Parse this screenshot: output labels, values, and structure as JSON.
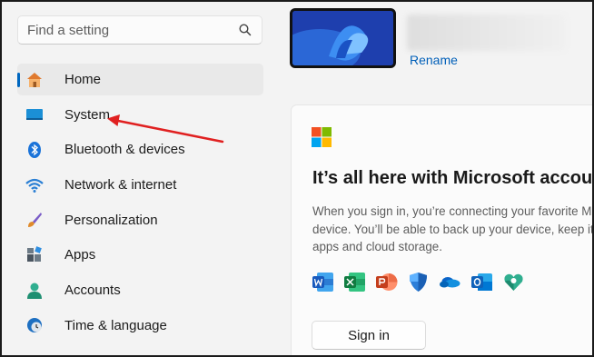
{
  "search": {
    "placeholder": "Find a setting",
    "icon": "search-icon"
  },
  "sidebar": {
    "items": [
      {
        "label": "Home",
        "icon": "home-icon",
        "selected": true
      },
      {
        "label": "System",
        "icon": "system-icon",
        "selected": false
      },
      {
        "label": "Bluetooth & devices",
        "icon": "bluetooth-icon",
        "selected": false
      },
      {
        "label": "Network & internet",
        "icon": "wifi-icon",
        "selected": false
      },
      {
        "label": "Personalization",
        "icon": "brush-icon",
        "selected": false
      },
      {
        "label": "Apps",
        "icon": "apps-icon",
        "selected": false
      },
      {
        "label": "Accounts",
        "icon": "person-icon",
        "selected": false
      },
      {
        "label": "Time & language",
        "icon": "clock-globe-icon",
        "selected": false
      }
    ]
  },
  "device": {
    "rename_label": "Rename"
  },
  "account_card": {
    "title": "It’s all here with Microsoft account",
    "description_lines": [
      "When you sign in, you’re connecting your favorite M",
      "device. You’ll be able to back up your device, keep it",
      "apps and cloud storage."
    ],
    "app_icons": [
      "word-icon",
      "excel-icon",
      "powerpoint-icon",
      "defender-icon",
      "onedrive-icon",
      "outlook-icon",
      "family-icon"
    ],
    "sign_in_label": "Sign in"
  },
  "colors": {
    "accent": "#0067c0",
    "link": "#005fb8",
    "annotation_arrow": "#e02020"
  }
}
